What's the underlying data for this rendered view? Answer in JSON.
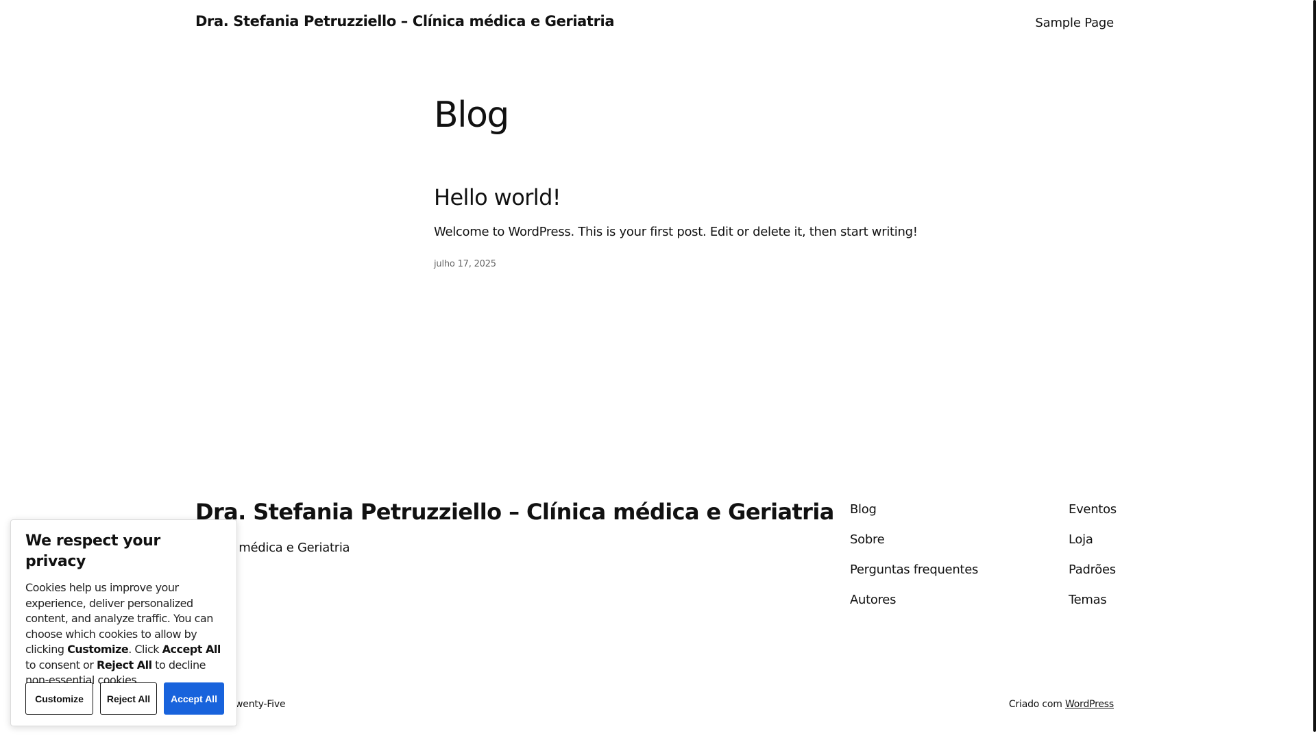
{
  "header": {
    "site_title": "Dra. Stefania Petruzziello – Clínica médica e Geriatria",
    "nav_sample_page": "Sample Page"
  },
  "main": {
    "page_title": "Blog",
    "post": {
      "title": "Hello world!",
      "excerpt": "Welcome to WordPress. This is your first post. Edit or delete it, then start writing!",
      "date": "julho 17, 2025"
    }
  },
  "footer": {
    "title": "Dra. Stefania Petruzziello – Clínica médica e Geriatria",
    "tagline": "Clínica médica e Geriatria",
    "col1": [
      "Blog",
      "Sobre",
      "Perguntas frequentes",
      "Autores"
    ],
    "col2": [
      "Eventos",
      "Loja",
      "Padrões",
      "Temas"
    ],
    "theme_credit": "Twenty Twenty-Five",
    "credit_prefix": "Criado com ",
    "credit_link": "WordPress"
  },
  "cookie": {
    "title": "We respect your privacy",
    "text_1": "Cookies help us improve your experience, deliver personalized content, and analyze traffic. You can choose which cookies to allow by clicking ",
    "text_customize": "Customize",
    "text_2": ". Click ",
    "text_accept": "Accept All",
    "text_3": " to consent or ",
    "text_reject": "Reject All",
    "text_4": " to decline non-essential cookies.",
    "btn_customize": "Customize",
    "btn_reject": "Reject All",
    "btn_accept": "Accept All"
  },
  "colors": {
    "accent": "#1863dc",
    "text": "#111111"
  }
}
